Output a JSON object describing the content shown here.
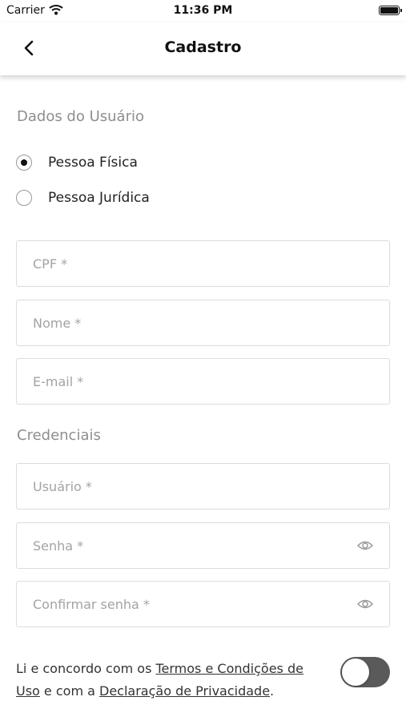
{
  "status_bar": {
    "carrier": "Carrier",
    "time": "11:36 PM"
  },
  "nav": {
    "title": "Cadastro"
  },
  "sections": {
    "user_data": "Dados do Usuário",
    "credentials": "Credenciais"
  },
  "person_type": {
    "options": [
      {
        "label": "Pessoa Física",
        "selected": true
      },
      {
        "label": "Pessoa Jurídica",
        "selected": false
      }
    ]
  },
  "fields": {
    "cpf": {
      "placeholder": "CPF *",
      "value": ""
    },
    "nome": {
      "placeholder": "Nome *",
      "value": ""
    },
    "email": {
      "placeholder": "E-mail *",
      "value": ""
    },
    "usuario": {
      "placeholder": "Usuário *",
      "value": ""
    },
    "senha": {
      "placeholder": "Senha *",
      "value": ""
    },
    "confirmar": {
      "placeholder": "Confirmar senha *",
      "value": ""
    }
  },
  "terms": {
    "text_1": "Li e concordo com os ",
    "link_terms": "Termos e Condições de Uso",
    "text_2": " e com a ",
    "link_privacy": "Declaração de Privacidade",
    "text_3": ".",
    "accepted": false
  },
  "icons": {
    "back": "chevron-left-icon",
    "wifi": "wifi-icon",
    "battery": "battery-icon",
    "eye": "eye-icon"
  }
}
